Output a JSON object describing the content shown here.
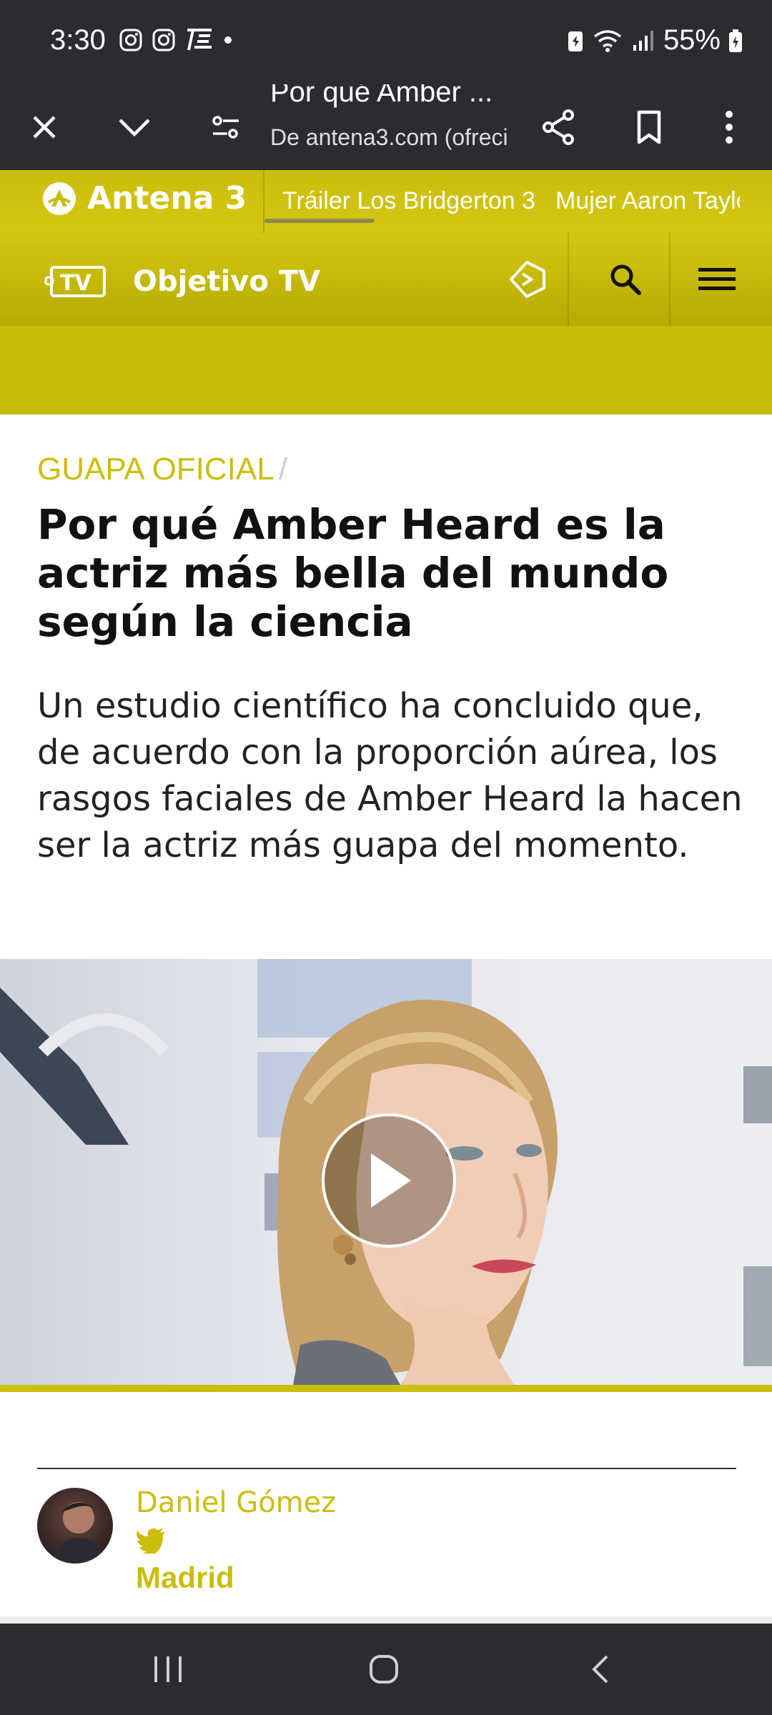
{
  "status_bar": {
    "time": "3:30",
    "battery": "55%"
  },
  "custom_tab": {
    "title": "Por qué Amber ...",
    "url": "De antena3.com (ofreci"
  },
  "site_header": {
    "brand": "Antena 3",
    "trending": [
      "Tráiler Los Bridgerton 3",
      "Mujer Aaron Taylo"
    ],
    "section_brand": "Objetivo TV"
  },
  "article": {
    "section": "GUAPA OFICIAL",
    "section_separator": "/",
    "headline": "Por qué Amber Heard es la actriz más bella del mundo según la ciencia",
    "subtitle": "Un estudio científico ha concluido que, de acuerdo con la proporción aúrea, los rasgos faciales de Amber Heard la hacen ser la actriz más guapa del momento."
  },
  "author": {
    "name": "Daniel Gómez",
    "location": "Madrid"
  },
  "colors": {
    "accent_yellow": "#cbbd0c",
    "dark_bar": "#2b2c31"
  }
}
